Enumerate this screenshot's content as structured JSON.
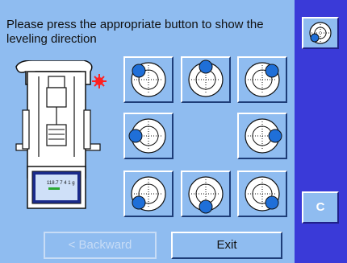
{
  "instruction": "Please press the appropriate button to show the leveling direction",
  "buttons": {
    "backward": "< Backward",
    "exit": "Exit",
    "clear": "C"
  },
  "display_readout": "118.7 7 4 1 g",
  "grid": [
    {
      "name": "level-up-left"
    },
    {
      "name": "level-up"
    },
    {
      "name": "level-up-right"
    },
    {
      "name": "level-left"
    },
    {
      "name": "level-right"
    },
    {
      "name": "level-down-left"
    },
    {
      "name": "level-down"
    },
    {
      "name": "level-down-right"
    }
  ],
  "colors": {
    "background": "#8fbcf0",
    "sidebar": "#3a3ad8",
    "bubble": "#1f6fd8",
    "indicator": "#ff2020"
  }
}
